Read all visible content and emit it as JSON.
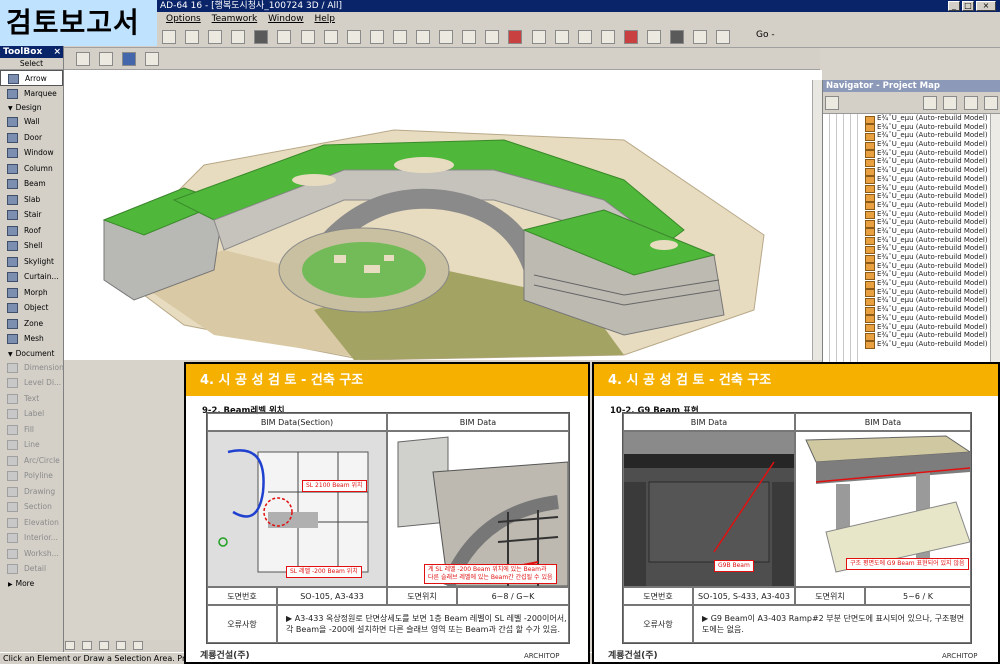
{
  "window": {
    "title": "AD-64 16 - [행복도시청사_100724 3D / All]",
    "controls": [
      "_",
      "□",
      "×"
    ]
  },
  "doc_title": "검토보고서",
  "menu": [
    "Options",
    "Teamwork",
    "Window",
    "Help"
  ],
  "toolbar": {
    "go_label": "Go -"
  },
  "toolbox": {
    "header": "ToolBox",
    "close": "×",
    "select_label": "Select",
    "select_tools": [
      "Arrow",
      "Marquee"
    ],
    "design_label": "Design",
    "design_tools": [
      "Wall",
      "Door",
      "Window",
      "Column",
      "Beam",
      "Slab",
      "Stair",
      "Roof",
      "Shell",
      "Skylight",
      "Curtain...",
      "Morph",
      "Object",
      "Zone",
      "Mesh"
    ],
    "document_label": "Document",
    "document_tools": [
      "Dimension",
      "Level Di...",
      "Text",
      "Label",
      "Fill",
      "Line",
      "Arc/Circle",
      "Polyline",
      "Drawing",
      "Section",
      "Elevation",
      "Interior...",
      "Worksh...",
      "Detail"
    ],
    "more_label": "More"
  },
  "navigator": {
    "title": "Navigator - Project Map",
    "item_label": "E¾ˆU_eµu (Auto-rebuild Model)",
    "item_count": 27
  },
  "statusbar": {
    "text": "Click an Element or Draw a Selection Area. Press and"
  },
  "slide_left": {
    "heading": "4. 시 공 성  검 토 - 건축 구조",
    "subheading": "9-2. Beam레벨 위치",
    "col_left": "BIM Data(Section)",
    "col_right": "BIM Data",
    "row_label_1": "도면번호",
    "value_left_1": "SO-105, A3-433",
    "row_label_2": "도면위치",
    "value_right_1": "6~8 / G~K",
    "row_label_3": "오류사항",
    "note": "▶ A3-433 옥상정원로 단면상세도를 보면 1층 Beam 레벨이 SL 레벨 -200이어서,\n각 Beam을 -200에 설치하면 다른 슬래브 영역 또는 Beam과 간섭 할 수가 있음.",
    "callout_1": "SL 2100 Beam 위치",
    "callout_2": "SL 레벨 -200 Beam 위치",
    "callout_3": "계 SL 레벨 -200 Beam 위치에 있는 Beam과\n다른 슬래브 레벨에 있는 Beam간 간섭될 수 있음",
    "logo": "계룡건설(주)",
    "logo_right": "ARCHITOP"
  },
  "slide_right": {
    "heading": "4. 시 공 성  검 토 - 건축 구조",
    "subheading": "10-2. G9 Beam 표현",
    "col_left": "BIM Data",
    "col_right": "BIM Data",
    "row_label_1": "도면번호",
    "value_left_1": "SO-105, S-433, A3-403",
    "row_label_2": "도면위치",
    "value_right_1": "5~6 / K",
    "row_label_3": "오류사항",
    "note": "▶ G9 Beam이 A3-403 Ramp#2 부분 단면도에 표시되어 있으나, 구조평면도에는 없음.",
    "callout_1": "G9B Beam",
    "callout_2": "구조 평면도에 G9 Beam 표현되어 있지 않음",
    "logo": "계룡건설(주)",
    "logo_right": "ARCHITOP"
  },
  "colors": {
    "slide_accent": "#f5b000",
    "title_bg": "#0a246a",
    "banner_bg": "#bfe3ff",
    "roof_green": "#4fb83a",
    "callout_red": "#e01010"
  }
}
